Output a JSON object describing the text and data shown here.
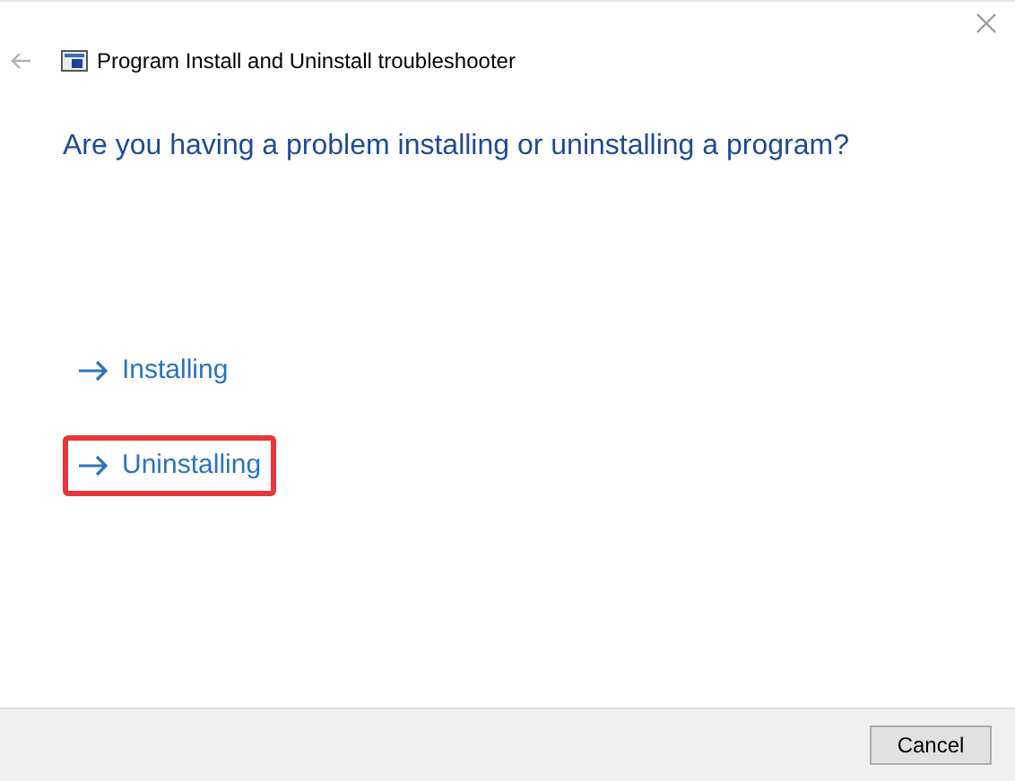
{
  "window": {
    "title": "Program Install and Uninstall troubleshooter"
  },
  "question": "Are you having a problem installing or uninstalling a program?",
  "options": [
    {
      "label": "Installing",
      "highlighted": false
    },
    {
      "label": "Uninstalling",
      "highlighted": true
    }
  ],
  "buttons": [
    "Cancel"
  ]
}
